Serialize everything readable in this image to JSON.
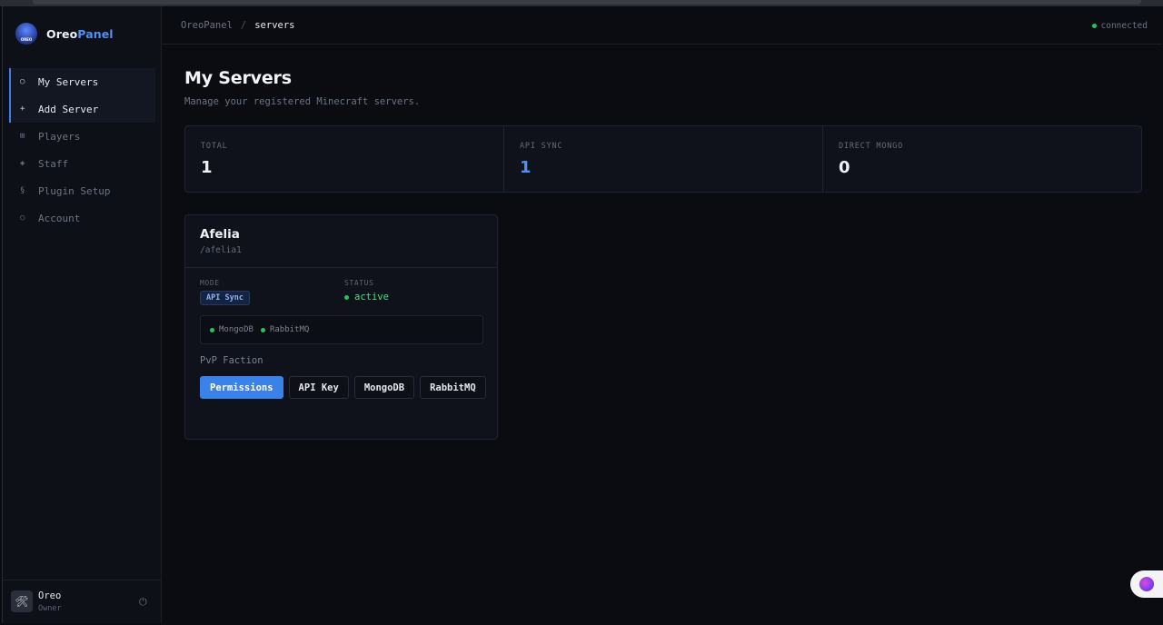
{
  "brand": {
    "name_main": "Oreo",
    "name_accent": "Panel",
    "logo_text": "OREO"
  },
  "sidebar": {
    "items": [
      {
        "icon": "○",
        "label": "My Servers"
      },
      {
        "icon": "+",
        "label": "Add Server"
      },
      {
        "icon": "⊞",
        "label": "Players"
      },
      {
        "icon": "◈",
        "label": "Staff"
      },
      {
        "icon": "§",
        "label": "Plugin Setup"
      },
      {
        "icon": "○",
        "label": "Account"
      }
    ]
  },
  "user": {
    "avatar": "🛠",
    "name": "Oreo",
    "role": "Owner",
    "power_icon": "⏻"
  },
  "header": {
    "breadcrumb": [
      "OreoPanel",
      "servers"
    ],
    "separator": "/",
    "status": "connected"
  },
  "page": {
    "title": "My Servers",
    "subtitle": "Manage your registered Minecraft servers."
  },
  "stats": [
    {
      "label": "TOTAL",
      "value": "1"
    },
    {
      "label": "API SYNC",
      "value": "1"
    },
    {
      "label": "DIRECT MONGO",
      "value": "0"
    }
  ],
  "server": {
    "name": "Afelia",
    "slug": "/afelia1",
    "mode_label": "MODE",
    "mode": "API Sync",
    "status_label": "STATUS",
    "status": "active",
    "connections": [
      "MongoDB",
      "RabbitMQ"
    ],
    "gamemode": "PvP Faction",
    "actions": [
      "Permissions",
      "API Key",
      "MongoDB",
      "RabbitMQ"
    ]
  },
  "colors": {
    "accent": "#3b82e8",
    "success": "#22c55e",
    "background": "#0a0c11"
  }
}
